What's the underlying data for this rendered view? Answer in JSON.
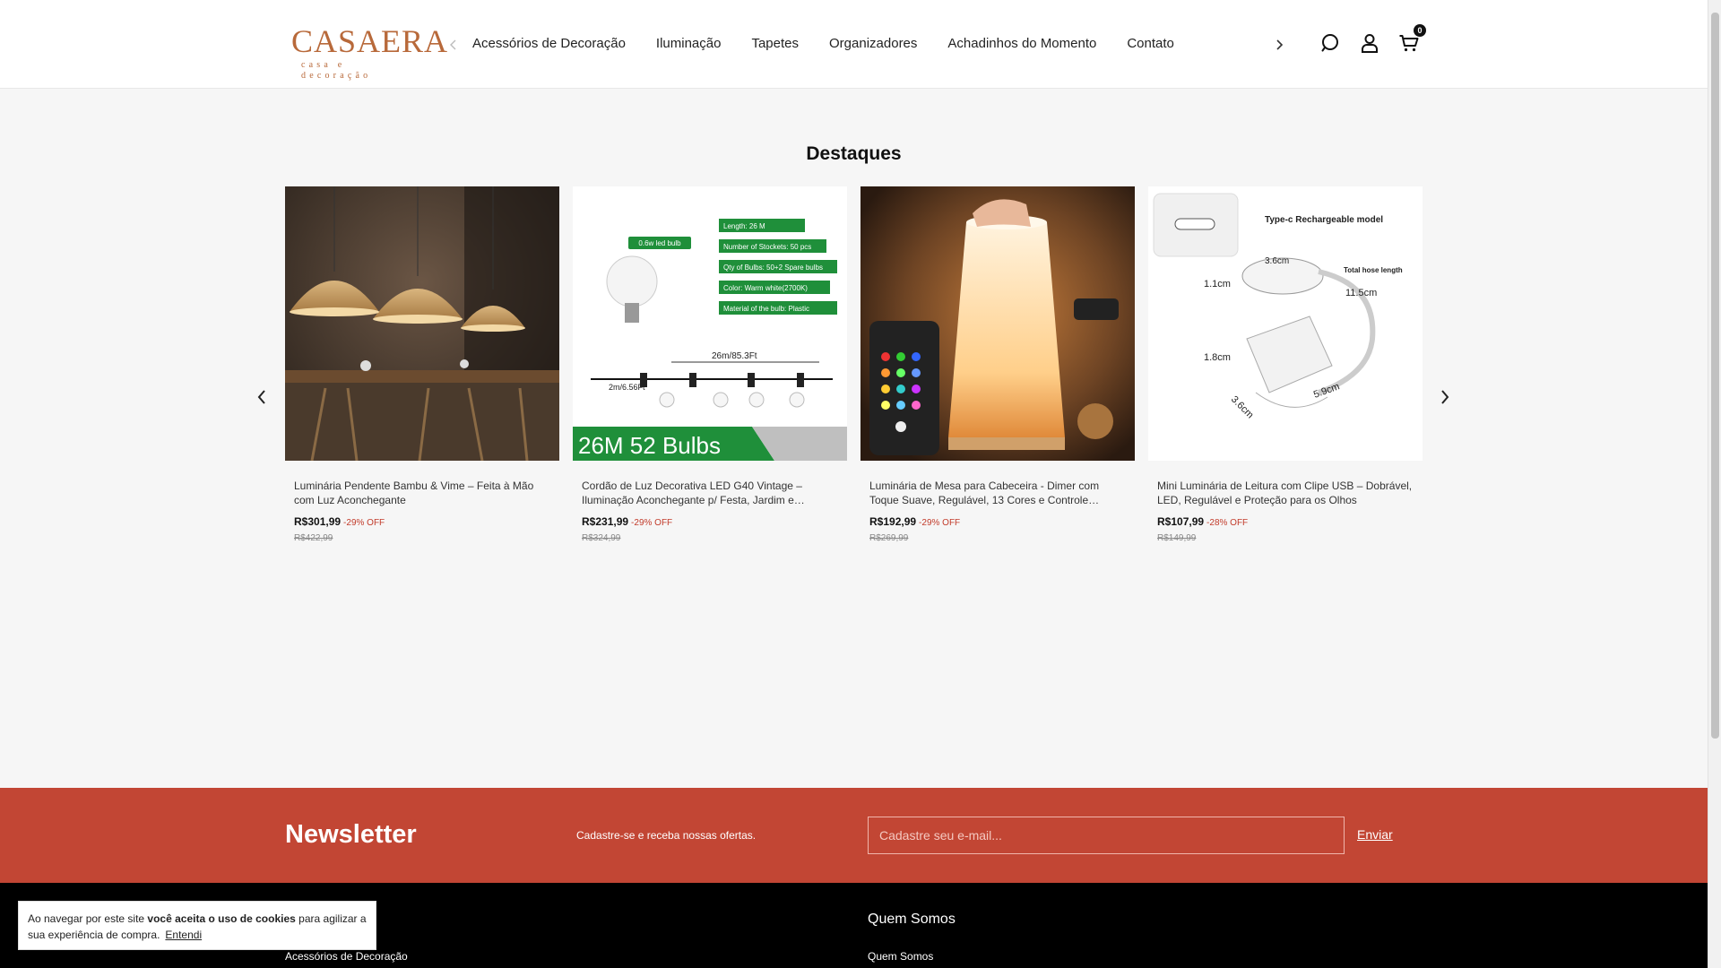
{
  "header": {
    "logo": {
      "main": "CASAERA",
      "sub": "casa e decoração"
    },
    "nav": [
      {
        "label": "Acessórios de Decoração"
      },
      {
        "label": "Iluminação"
      },
      {
        "label": "Tapetes"
      },
      {
        "label": "Organizadores"
      },
      {
        "label": "Achadinhos do Momento"
      },
      {
        "label": "Contato"
      }
    ],
    "icons": {
      "prev": "chevron-left-icon",
      "next": "chevron-right-icon",
      "search": "search-icon",
      "account": "user-icon",
      "cart": "cart-icon"
    },
    "cart_count": "0"
  },
  "highlights": {
    "title": "Destaques",
    "products": [
      {
        "name": "Luminária Pendente Bambu & Vime – Feita à Mão com Luz Aconchegante",
        "price": "R$301,99",
        "discount": "-29% OFF",
        "old_price": "R$422,99"
      },
      {
        "name": "Cordão de Luz Decorativa LED G40 Vintage – Iluminação Aconchegante p/ Festa, Jardim e…",
        "price": "R$231,99",
        "discount": "-29% OFF",
        "old_price": "R$324,99",
        "image_text": {
          "bulb": "0.6w led bulb",
          "length": "Length: 26 M",
          "sockets": "Number of Stockets: 50 pcs",
          "qty": "Qty of Bulbs: 50+2 Spare bulbs",
          "color": "Color: Warm white(2700K)",
          "material": "Material of the bulb: Plastic",
          "dim1": "26m/85.3Ft",
          "dim2": "2m/6.56Ft",
          "banner": "26M  52 Bulbs"
        }
      },
      {
        "name": "Luminária de Mesa para Cabeceira - Dimer com Toque Suave, Regulável, 13 Cores e Controle…",
        "price": "R$192,99",
        "discount": "-29% OFF",
        "old_price": "R$269,99"
      },
      {
        "name": "Mini Luminária de Leitura com Clipe USB – Dobrável, LED, Regulável e Proteção para os Olhos",
        "price": "R$107,99",
        "discount": "-28% OFF",
        "old_price": "R$149,99",
        "image_text": {
          "title": "Type-c Rechargeable model",
          "d1": "3.6cm",
          "d2": "Total hose length",
          "d3": "11.5cm",
          "d4": "1.1cm",
          "d5": "1.8cm",
          "d6": "3.6cm",
          "d7": "5.9cm"
        }
      }
    ]
  },
  "newsletter": {
    "title": "Newsletter",
    "text": "Cadastre-se e receba nossas ofertas.",
    "placeholder": "Cadastre seu e-mail...",
    "button": "Enviar"
  },
  "footer": {
    "heading": "Quem Somos",
    "link_left": "Acessórios de Decoração",
    "link_right": "Quem Somos"
  },
  "cookie": {
    "text_before": "Ao navegar por este site ",
    "text_bold": "você aceita o uso de cookies",
    "text_after": " para agilizar a sua experiência de compra.",
    "button": "Entendi"
  },
  "colors": {
    "brand": "#b8693a",
    "newsletter_bg": "#c24634",
    "discount": "#c23b2a"
  }
}
